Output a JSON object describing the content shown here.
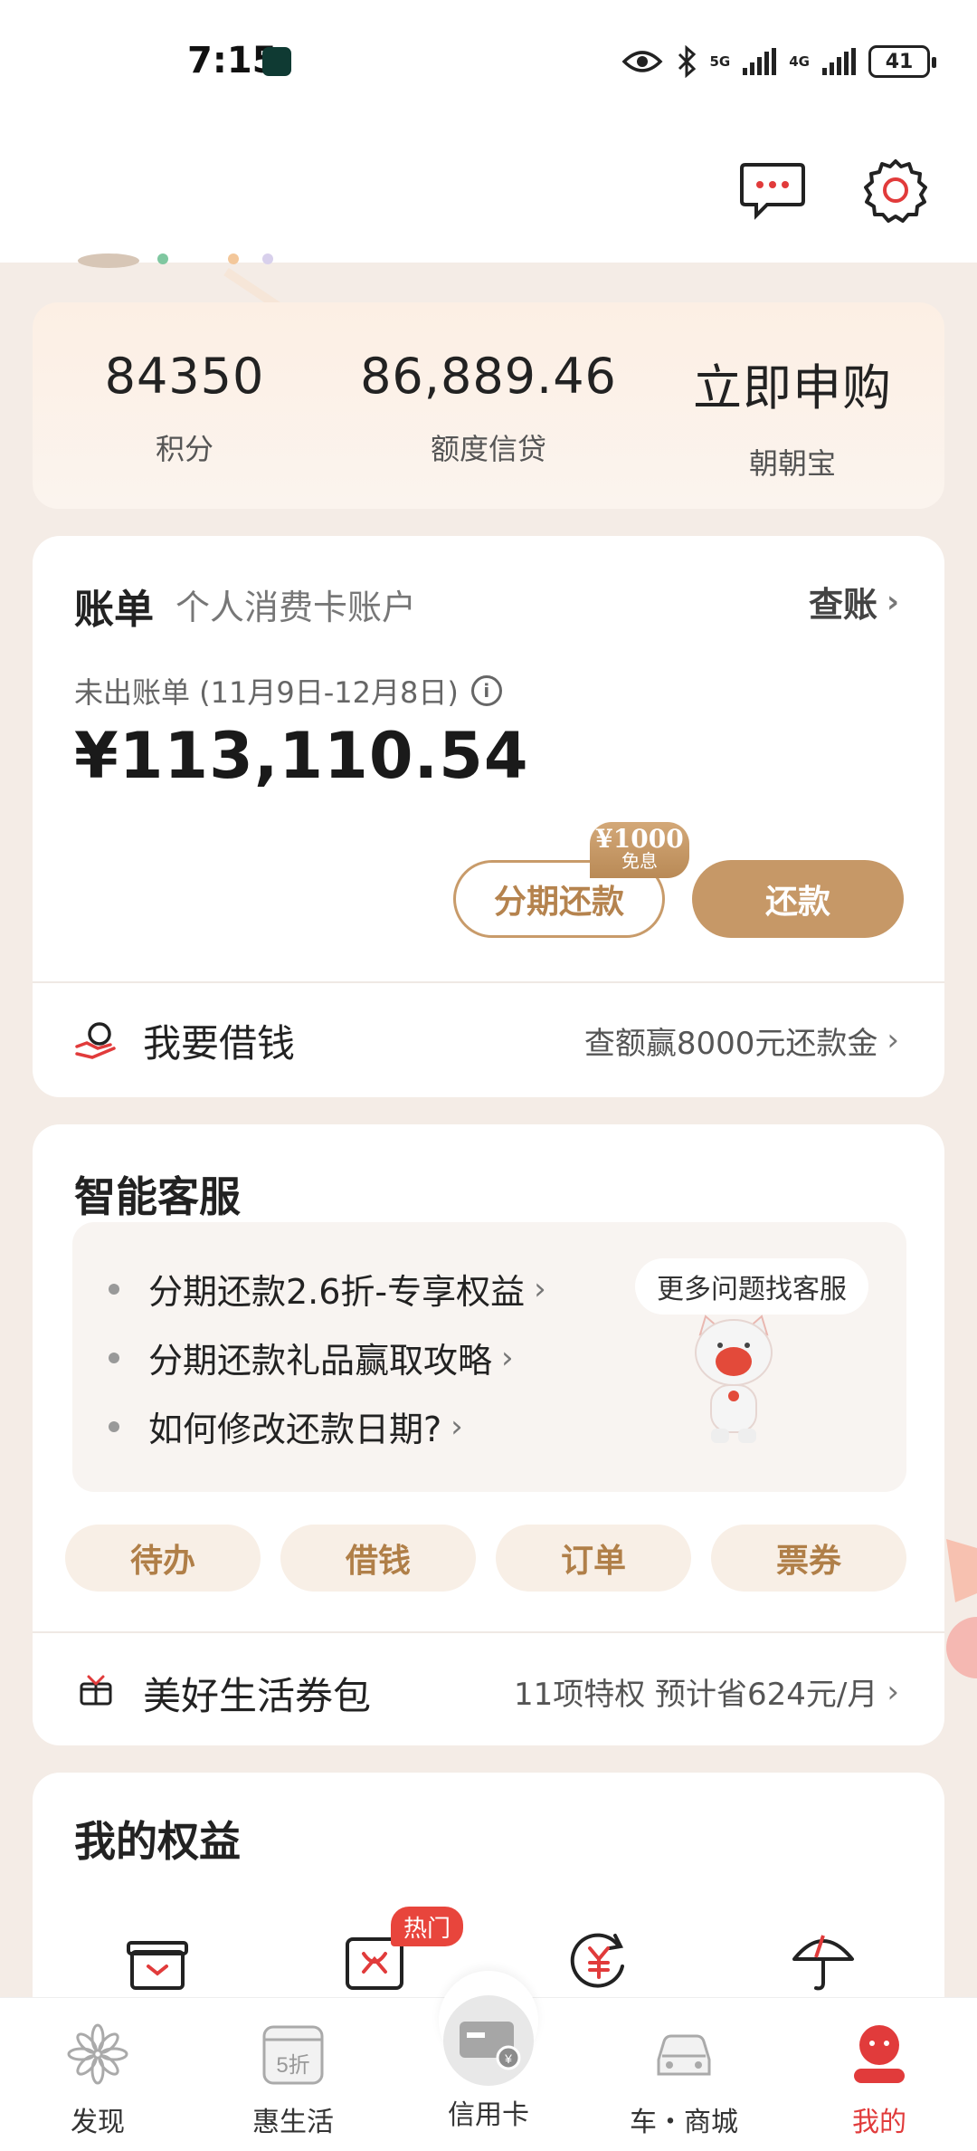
{
  "status_bar": {
    "time": "7:15",
    "net1": "5G",
    "net2": "4G",
    "battery": "41"
  },
  "header": {
    "message_icon": "chat-bubble-icon",
    "settings_icon": "gear-icon"
  },
  "summary": {
    "items": [
      {
        "value": "84350",
        "label": "积分"
      },
      {
        "value": "86,889.46",
        "label": "额度信贷"
      },
      {
        "value": "立即申购",
        "label": "朝朝宝"
      }
    ]
  },
  "bill": {
    "title": "账单",
    "subtitle": "个人消费卡账户",
    "check_link": "查账",
    "unbilled_label": "未出账单 (11月9日-12月8日)",
    "amount": "¥113,110.54",
    "installment_button": "分期还款",
    "badge_top": "¥1000",
    "badge_bottom": "免息",
    "repay_button": "还款",
    "borrow_label": "我要借钱",
    "borrow_promo": "查额赢8000元还款金"
  },
  "service": {
    "title": "智能客服",
    "faq": [
      "分期还款2.6折-专享权益",
      "分期还款礼品赢取攻略",
      "如何修改还款日期?"
    ],
    "more_help": "更多问题找客服",
    "quick_actions": [
      "待办",
      "借钱",
      "订单",
      "票券"
    ],
    "coupon_label": "美好生活券包",
    "coupon_promo": "11项特权 预计省624元/月"
  },
  "rights": {
    "title": "我的权益",
    "hot_badge": "热门",
    "icons": [
      "gift-box-icon",
      "coupon-ticket-icon",
      "yuan-cycle-icon",
      "umbrella-icon"
    ]
  },
  "bottom_nav": {
    "items": [
      {
        "label": "发现",
        "icon": "flower-icon"
      },
      {
        "label": "惠生活",
        "icon": "discount-calendar-icon"
      },
      {
        "label": "信用卡",
        "icon": "credit-card-icon"
      },
      {
        "label": "车・商城",
        "icon": "car-icon"
      },
      {
        "label": "我的",
        "icon": "profile-icon"
      }
    ],
    "discount_text": "5折",
    "active_color": "#e13b3b"
  },
  "colors": {
    "accent_gold": "#c69867",
    "background": "#f4ece6"
  }
}
